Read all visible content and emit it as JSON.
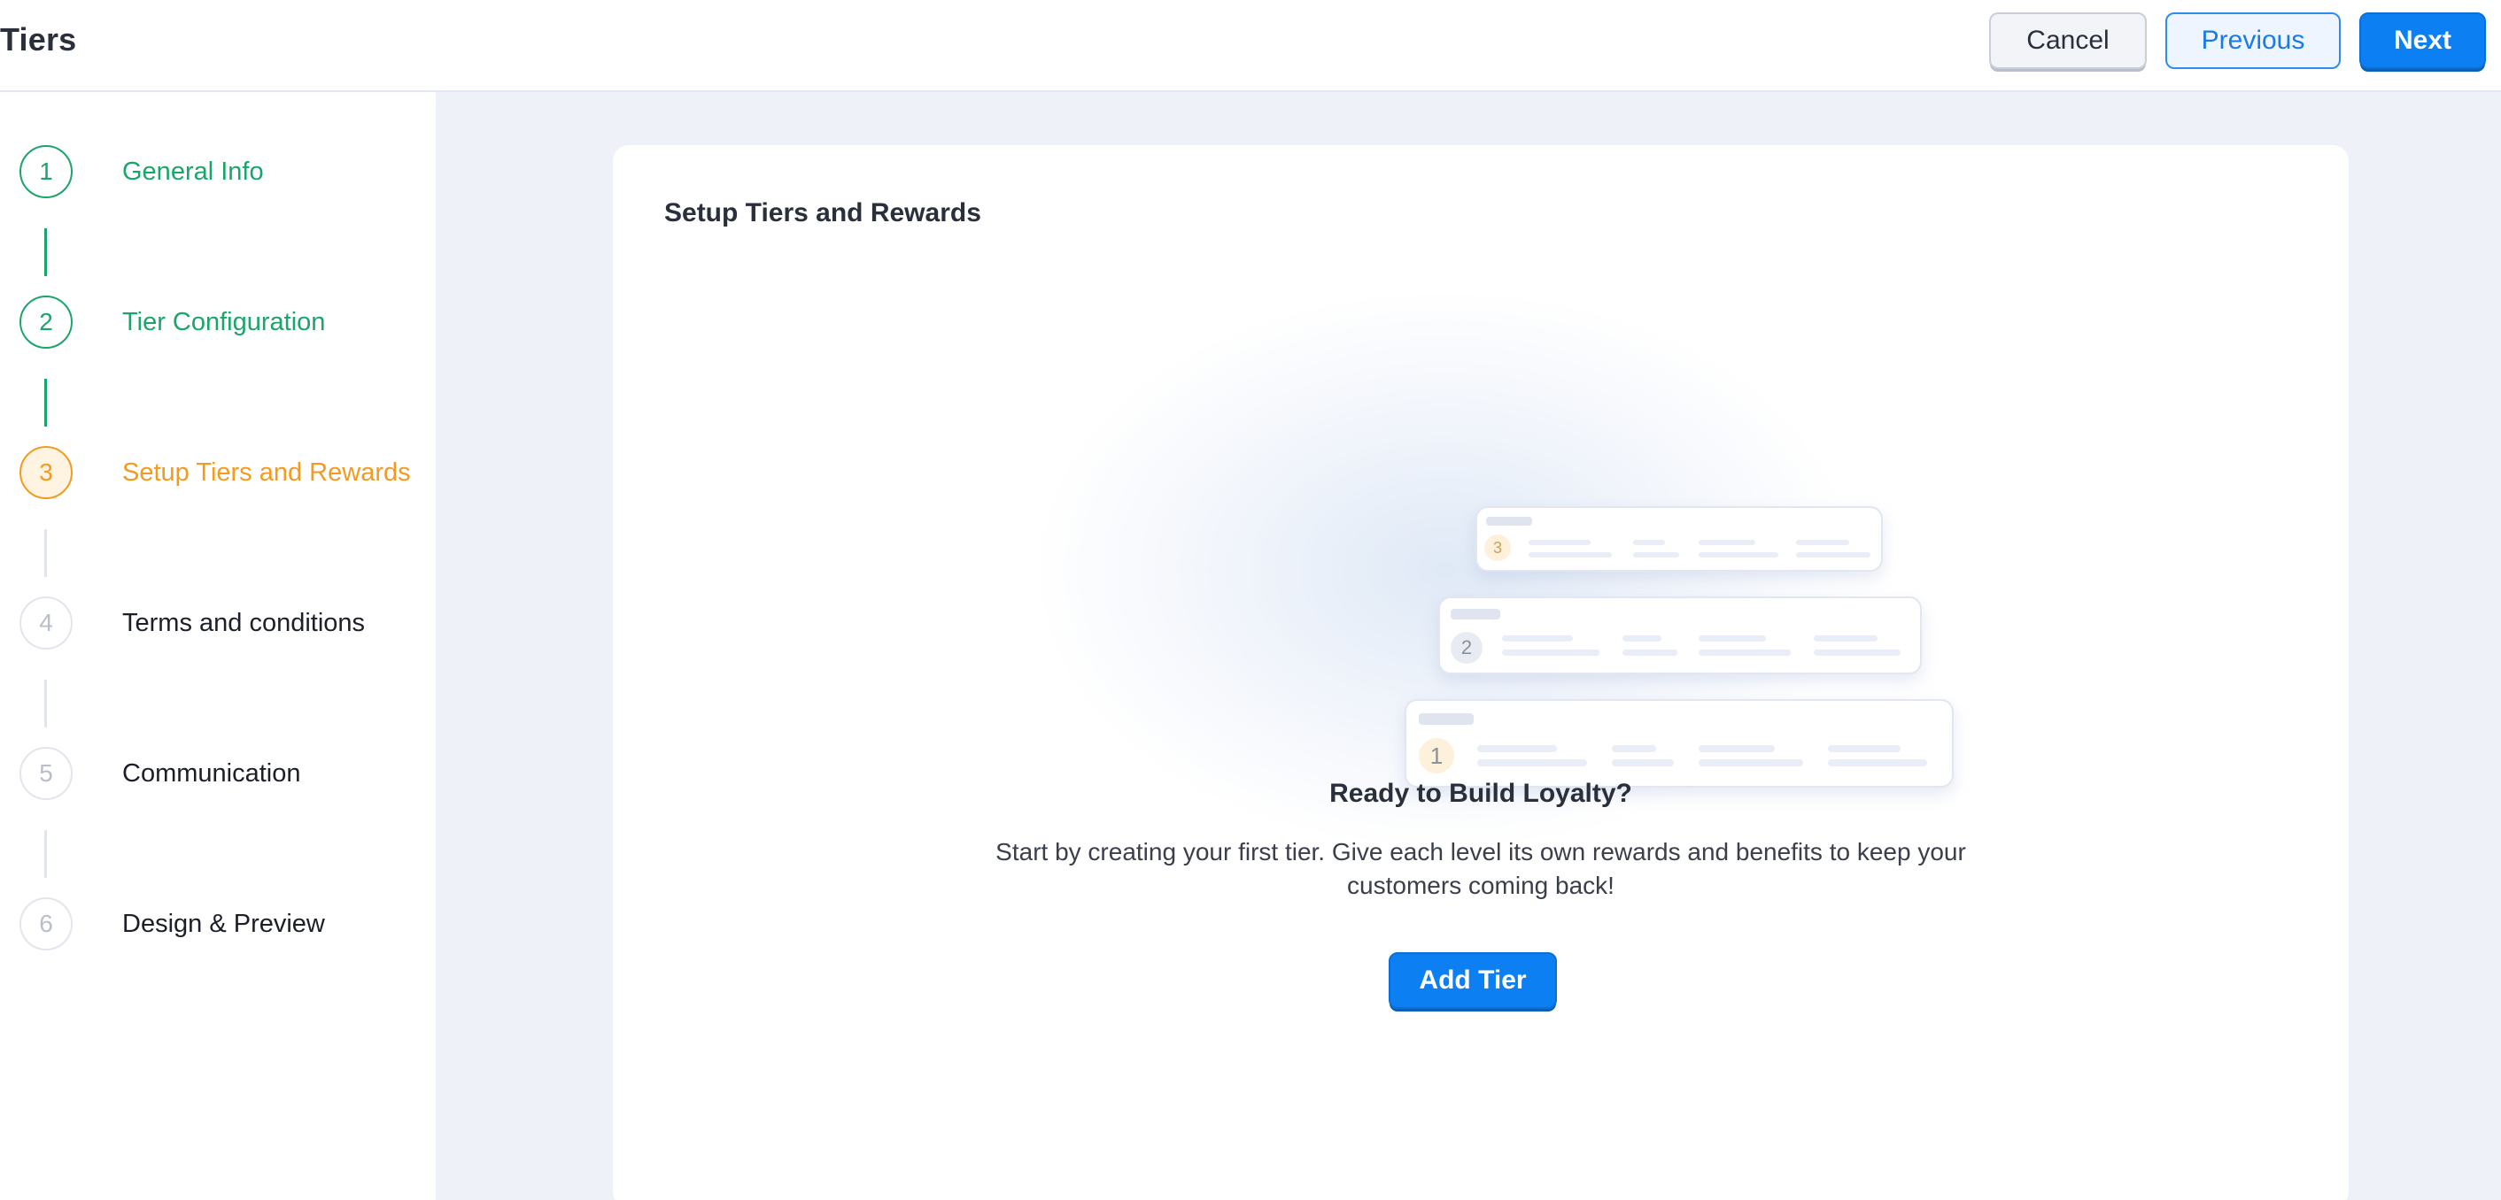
{
  "header": {
    "title": "Tiers",
    "cancel_label": "Cancel",
    "previous_label": "Previous",
    "next_label": "Next"
  },
  "steps": [
    {
      "number": "1",
      "label": "General Info",
      "state": "completed"
    },
    {
      "number": "2",
      "label": "Tier Configuration",
      "state": "completed"
    },
    {
      "number": "3",
      "label": "Setup Tiers and Rewards",
      "state": "active"
    },
    {
      "number": "4",
      "label": "Terms and conditions",
      "state": "pending"
    },
    {
      "number": "5",
      "label": "Communication",
      "state": "pending"
    },
    {
      "number": "6",
      "label": "Design & Preview",
      "state": "pending"
    }
  ],
  "main": {
    "section_title": "Setup Tiers and Rewards",
    "illustration": {
      "tier_numbers": [
        "3",
        "2",
        "1"
      ]
    },
    "empty_state": {
      "title": "Ready to Build Loyalty?",
      "description": "Start by creating your first tier. Give each level its own rewards and benefits to keep your customers coming back!",
      "button_label": "Add Tier"
    }
  },
  "colors": {
    "completed": "#1aa56a",
    "active": "#f39a1f",
    "pending": "#b9bec9",
    "primary": "#0c7ff2",
    "main_background": "#eef1f8"
  }
}
